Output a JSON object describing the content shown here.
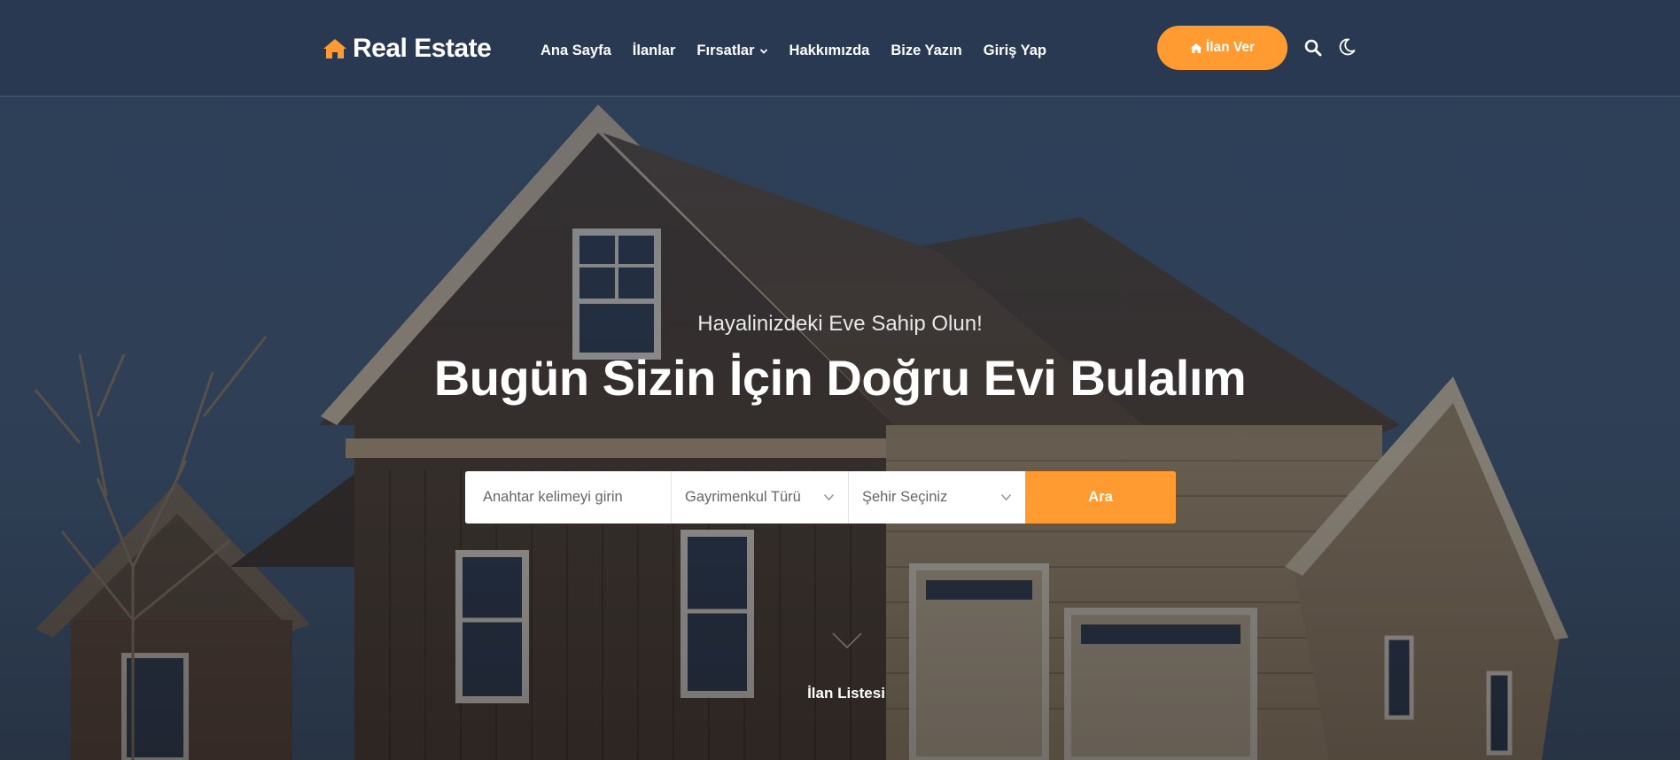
{
  "brand": {
    "name": "Real Estate",
    "icon": "home-icon",
    "accent_color": "#ff9b30"
  },
  "nav": {
    "items": [
      {
        "label": "Ana Sayfa"
      },
      {
        "label": "İlanlar"
      },
      {
        "label": "Fırsatlar",
        "icon": "chevron-down-icon"
      },
      {
        "label": "Hakkımızda"
      },
      {
        "label": "Bize Yazın"
      },
      {
        "label": "Giriş Yap"
      }
    ],
    "cta_label": "İlan Ver",
    "cta_icon": "home-icon",
    "search_icon": "search-icon",
    "theme_icon": "moon-icon"
  },
  "hero": {
    "subtitle": "Hayalinizdeki Eve Sahip Olun!",
    "title": "Bugün Sizin İçin Doğru Evi Bulalım"
  },
  "search": {
    "keyword_placeholder": "Anahtar kelimeyi girin",
    "property_type": "Gayrimenkul Türü",
    "city": "Şehir Seçiniz",
    "button": "Ara"
  },
  "scroll": {
    "label": "İlan Listesi",
    "icon": "chevron-down-icon"
  }
}
